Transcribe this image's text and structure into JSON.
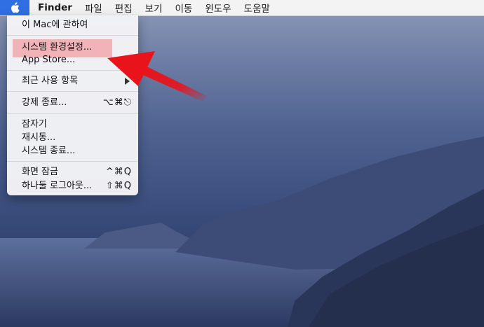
{
  "menubar": {
    "apple_icon": "apple-logo",
    "items": [
      "Finder",
      "파일",
      "편집",
      "보기",
      "이동",
      "윈도우",
      "도움말"
    ]
  },
  "apple_menu": {
    "about": "이 Mac에 관하여",
    "system_prefs": "시스템 환경설정...",
    "app_store": "App Store...",
    "recent_items": "최근 사용 항목",
    "force_quit": "강제 종료...",
    "force_quit_shortcut": "⌥⌘⎋",
    "sleep": "잠자기",
    "restart": "재시동...",
    "shutdown": "시스템 종료...",
    "lock_screen": "화면 잠금",
    "lock_screen_shortcut": "^⌘Q",
    "logout": "하나둘 로그아웃...",
    "logout_shortcut": "⇧⌘Q"
  },
  "colors": {
    "menubar_accent": "#2f6fe3",
    "highlight": "#f1b3b8",
    "annotation_arrow": "#e8131b"
  }
}
